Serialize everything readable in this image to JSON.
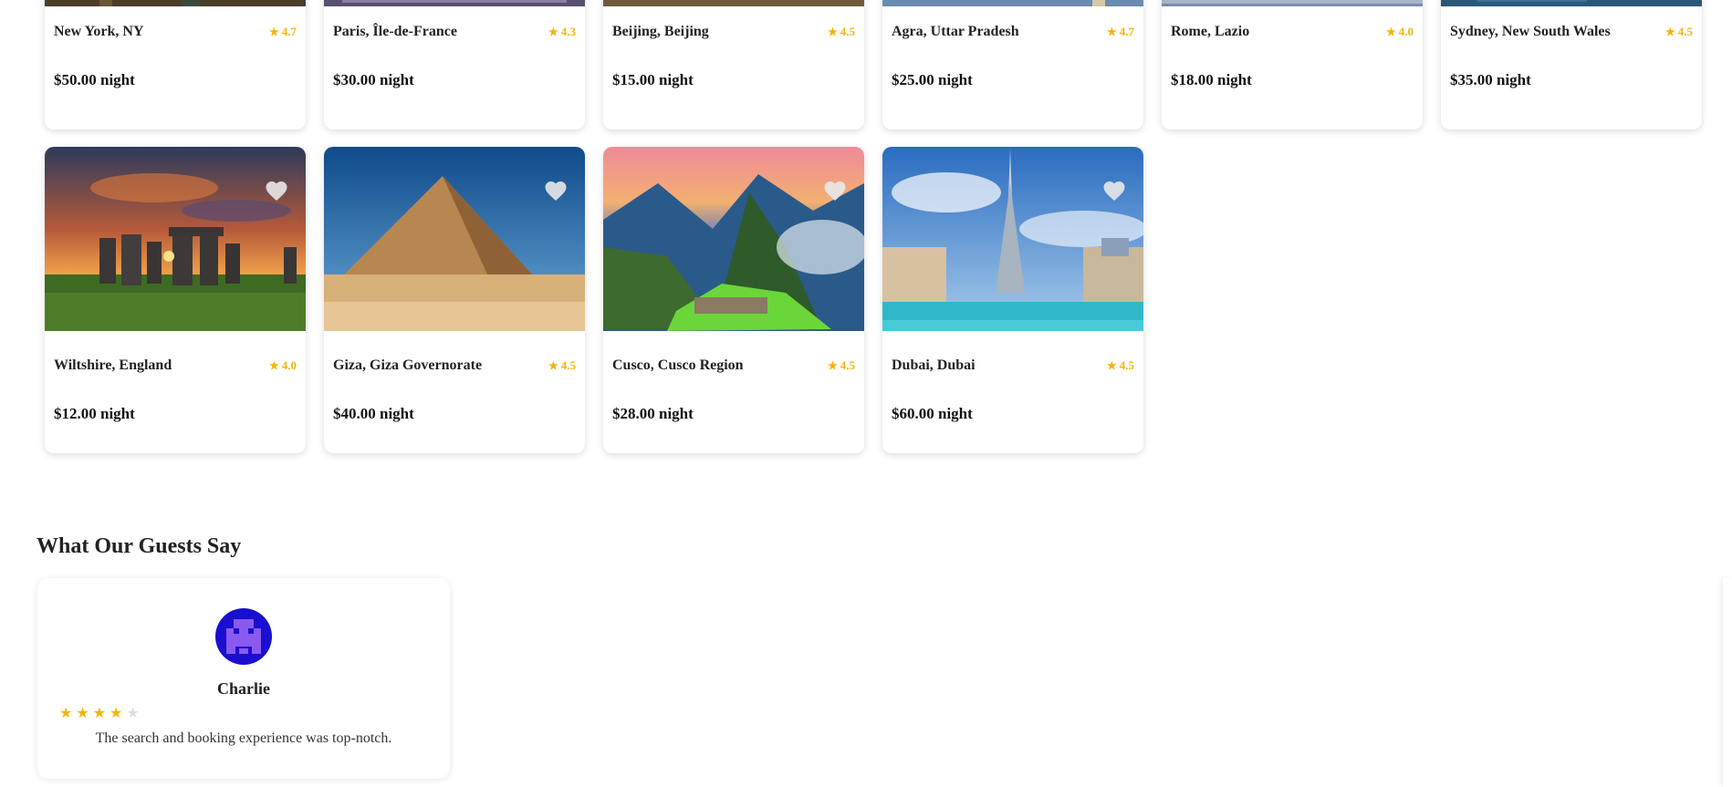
{
  "colors": {
    "star": "#f4b400",
    "star_empty": "#dddddd",
    "heart": "#e8e8e8"
  },
  "listings_row1": [
    {
      "location": "New York, NY",
      "rating": "4.7",
      "price": "$50.00 night"
    },
    {
      "location": "Paris, Île-de-France",
      "rating": "4.3",
      "price": "$30.00 night"
    },
    {
      "location": "Beijing, Beijing",
      "rating": "4.5",
      "price": "$15.00 night"
    },
    {
      "location": "Agra, Uttar Pradesh",
      "rating": "4.7",
      "price": "$25.00 night"
    },
    {
      "location": "Rome, Lazio",
      "rating": "4.0",
      "price": "$18.00 night"
    },
    {
      "location": "Sydney, New South Wales",
      "rating": "4.5",
      "price": "$35.00 night"
    }
  ],
  "listings_row2": [
    {
      "location": "Wiltshire, England",
      "rating": "4.0",
      "price": "$12.00 night",
      "icon": "favorite-heart-icon"
    },
    {
      "location": "Giza, Giza Governorate",
      "rating": "4.5",
      "price": "$40.00 night",
      "icon": "favorite-heart-icon"
    },
    {
      "location": "Cusco, Cusco Region",
      "rating": "4.5",
      "price": "$28.00 night",
      "icon": "favorite-heart-icon"
    },
    {
      "location": "Dubai, Dubai",
      "rating": "4.5",
      "price": "$60.00 night",
      "icon": "favorite-heart-icon"
    }
  ],
  "reviews": {
    "title": "What Our Guests Say",
    "items": [
      {
        "name": "Charlie",
        "stars": 4,
        "max_stars": 5,
        "text": "The search and booking experience was top-notch."
      }
    ]
  }
}
